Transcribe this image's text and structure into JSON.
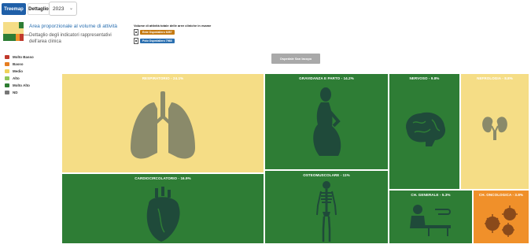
{
  "toolbar": {
    "tabs": [
      {
        "label": "Treemap",
        "active": true
      },
      {
        "label": "Dettaglio",
        "active": false
      }
    ],
    "year": "2023"
  },
  "info": {
    "area_text": "Area proporzionale al volume di attività",
    "detail_text": "Dettaglio degli indicatori rappresentativi dell'area clinica"
  },
  "totals": {
    "title": "Volume di attività totale delle aree cliniche in esame",
    "entity_badge": "Ente Ospedaliero 6287",
    "hospital_badge": "Polo Ospedaliero 7968"
  },
  "legend": [
    {
      "label": "Molto Basso",
      "color": "#c0392b"
    },
    {
      "label": "Basso",
      "color": "#e67e22"
    },
    {
      "label": "Medio",
      "color": "#f0d25a"
    },
    {
      "label": "Alto",
      "color": "#8fc65a"
    },
    {
      "label": "Molto Alto",
      "color": "#2e7d32"
    },
    {
      "label": "ND",
      "color": "#777777"
    }
  ],
  "hospital_button": "Ospedale San Iacopo",
  "treemap": {
    "tiles": [
      {
        "id": "respiratorio",
        "label": "RESPIRATORIO - 24.1%",
        "color": "#f5dd86",
        "icon": "lungs-icon"
      },
      {
        "id": "cardiocircolatorio",
        "label": "CARDIOCIRCOLATORIO - 16.9%",
        "color": "#2e7d35",
        "icon": "heart-icon"
      },
      {
        "id": "gravidanza",
        "label": "GRAVIDANZA E PARTO - 14.2%",
        "color": "#2e7d35",
        "icon": "pregnant-woman-icon"
      },
      {
        "id": "osteomuscolare",
        "label": "OSTEOMUSCOLARE - 11%",
        "color": "#2e7d35",
        "icon": "skeleton-icon"
      },
      {
        "id": "nervoso",
        "label": "NERVOSO - 9.8%",
        "color": "#2e7d35",
        "icon": "brain-icon"
      },
      {
        "id": "nefrologia",
        "label": "NEFROLOGIA - 8.8%",
        "color": "#f5dd86",
        "icon": "kidneys-icon"
      },
      {
        "id": "chgenerale",
        "label": "CH. GENERALE - 5.3%",
        "color": "#2e7d35",
        "icon": "surgery-icon"
      },
      {
        "id": "choncologica",
        "label": "CH. ONCOLOGICA - 3.8%",
        "color": "#f0902a",
        "icon": "cancer-cells-icon"
      }
    ]
  }
}
